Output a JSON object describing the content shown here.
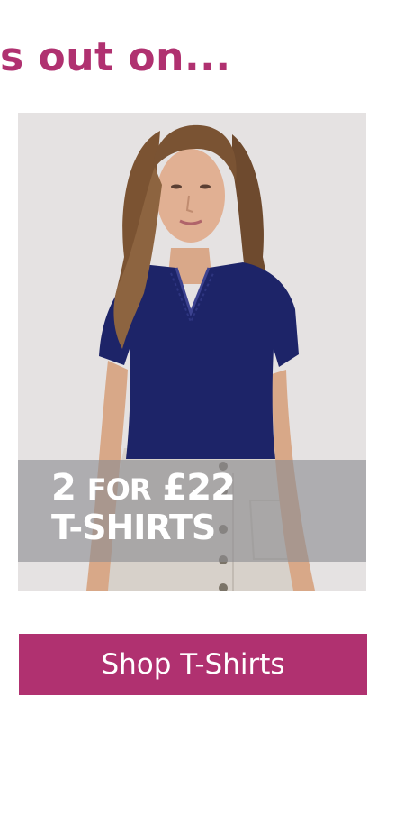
{
  "headline": "s out on...",
  "promo": {
    "image_alt": "Woman wearing a navy V-neck T-shirt with a beige button skirt",
    "offer_part1": "2",
    "offer_part2": "FOR",
    "offer_part3": "£22",
    "offer_line2": "T-SHIRTS"
  },
  "cta": {
    "label": "Shop T-Shirts"
  },
  "colors": {
    "brand": "#b03170",
    "shirt": "#1d2468",
    "band": "#8c8c92"
  }
}
